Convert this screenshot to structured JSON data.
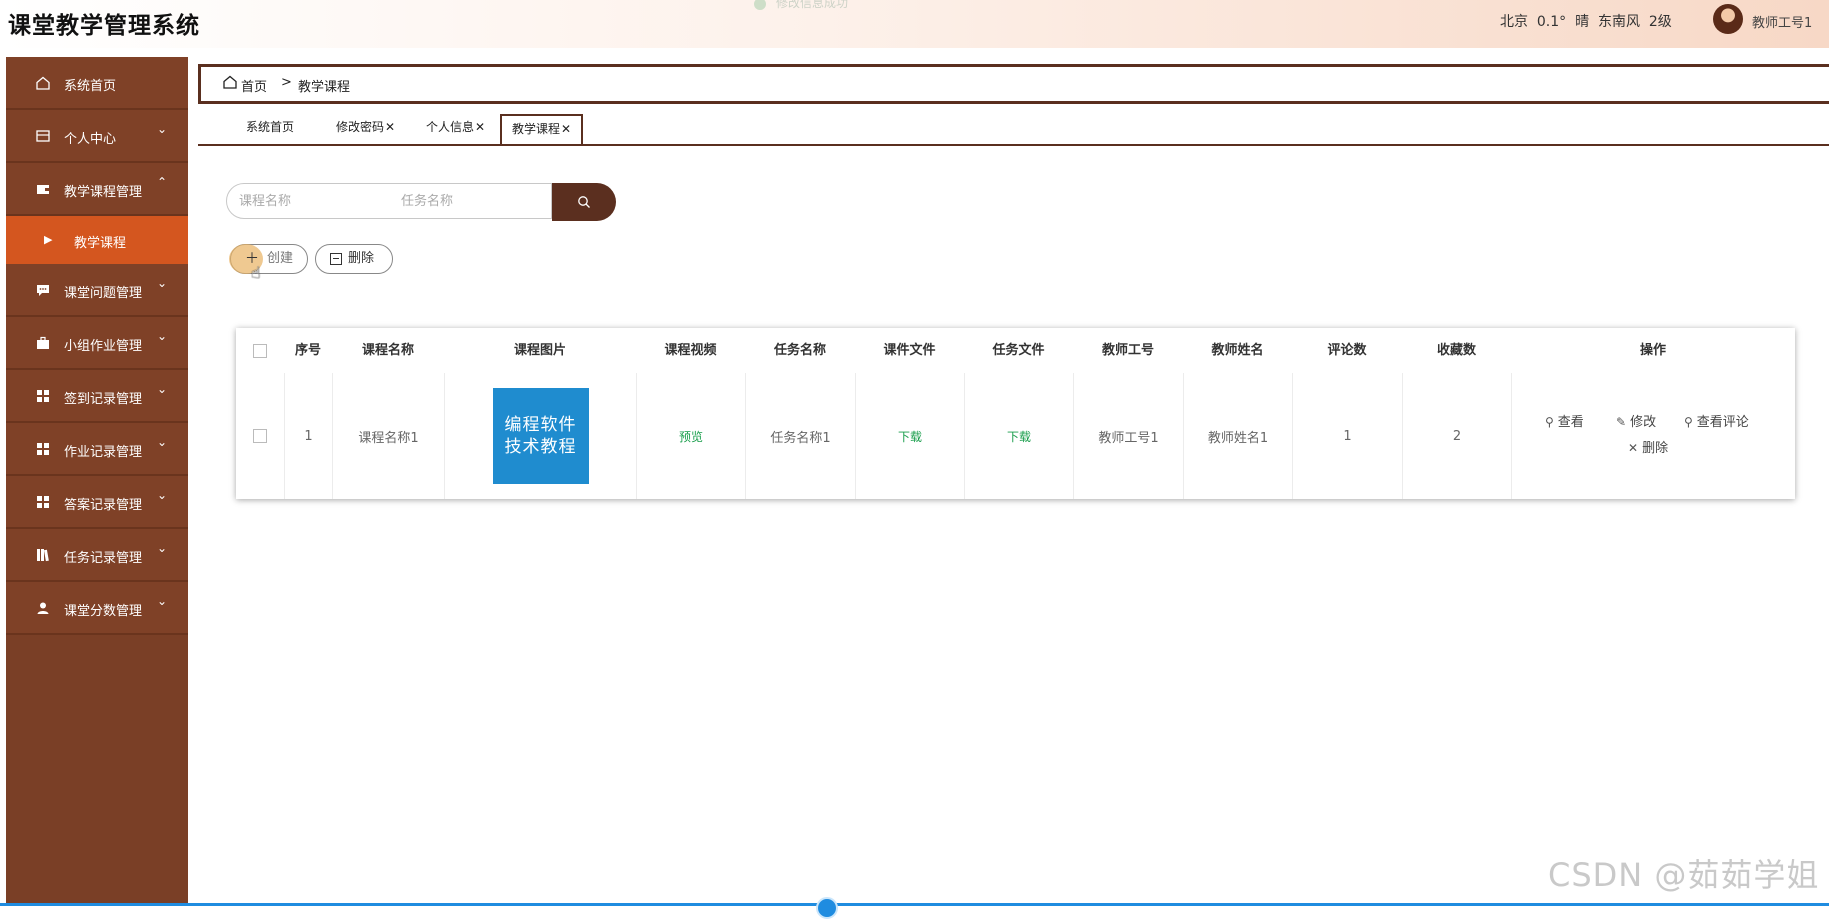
{
  "app": {
    "title": "课堂教学管理系统",
    "toast": "修改信息成功"
  },
  "header": {
    "weather": "北京  0.1°  晴  东南风  2级",
    "user_name": "教师工号1"
  },
  "sidebar": {
    "items": [
      {
        "label": "系统首页",
        "icon": "home-icon",
        "arrow": ""
      },
      {
        "label": "个人中心",
        "icon": "id-card-icon",
        "arrow": "⌄"
      },
      {
        "label": "教学课程管理",
        "icon": "wallet-icon",
        "arrow": "⌃"
      },
      {
        "label": "课堂问题管理",
        "icon": "chat-icon",
        "arrow": "⌄"
      },
      {
        "label": "小组作业管理",
        "icon": "briefcase-icon",
        "arrow": "⌄"
      },
      {
        "label": "签到记录管理",
        "icon": "grid-icon",
        "arrow": "⌄"
      },
      {
        "label": "作业记录管理",
        "icon": "grid-icon",
        "arrow": "⌄"
      },
      {
        "label": "答案记录管理",
        "icon": "grid-icon",
        "arrow": "⌄"
      },
      {
        "label": "任务记录管理",
        "icon": "books-icon",
        "arrow": "⌄"
      },
      {
        "label": "课堂分数管理",
        "icon": "user-icon",
        "arrow": "⌄"
      }
    ],
    "sub_active": "教学课程"
  },
  "breadcrumb": {
    "home": "首页",
    "separator": ">",
    "current": "教学课程"
  },
  "tabs": [
    {
      "label": "系统首页",
      "close": ""
    },
    {
      "label": "修改密码",
      "close": "✕"
    },
    {
      "label": "个人信息",
      "close": "✕"
    },
    {
      "label": "教学课程",
      "close": "✕"
    }
  ],
  "search": {
    "course_placeholder": "课程名称",
    "task_placeholder": "任务名称",
    "button_icon": "search-icon"
  },
  "actions": {
    "create_label": "创建",
    "delete_label": "删除"
  },
  "table": {
    "headers": [
      "序号",
      "课程名称",
      "课程图片",
      "课程视频",
      "任务名称",
      "课件文件",
      "任务文件",
      "教师工号",
      "教师姓名",
      "评论数",
      "收藏数",
      "操作"
    ],
    "rows": [
      {
        "index": "1",
        "course_name": "课程名称1",
        "image_text_line1": "编程软件",
        "image_text_line2": "技术教程",
        "video": "预览",
        "task_name": "任务名称1",
        "courseware": "下载",
        "task_file": "下载",
        "teacher_id": "教师工号1",
        "teacher_name": "教师姓名1",
        "comments": "1",
        "favorites": "2",
        "ops": {
          "view": "查看",
          "edit": "修改",
          "view_comments": "查看评论",
          "delete": "删除"
        }
      }
    ]
  },
  "watermark": "CSDN @茹茹学姐",
  "colors": {
    "sidebar": "#7a3f26",
    "active": "#d4561f",
    "dark_brown": "#5b2f1f",
    "link_green": "#1a9e4c",
    "image_blue": "#1f8ccf"
  }
}
